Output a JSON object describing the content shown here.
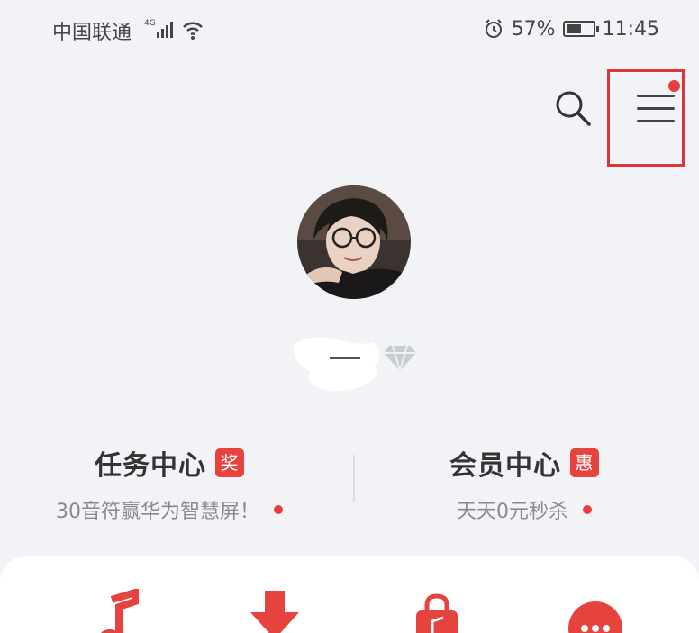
{
  "status_bar": {
    "carrier": "中国联通",
    "network": "4G",
    "battery": "57%",
    "battery_level": 0.57,
    "time": "11:45"
  },
  "header": {
    "search_icon": "search-icon",
    "menu_icon": "menu-icon"
  },
  "profile": {
    "vip_icon": "diamond-icon"
  },
  "task_center": {
    "title": "任务中心",
    "badge": "奖",
    "subtitle": "30音符赢华为智慧屏！"
  },
  "member_center": {
    "title": "会员中心",
    "badge": "惠",
    "subtitle": "天天0元秒杀"
  },
  "quick_icons": [
    "music-note-icon",
    "download-icon",
    "shopping-bag-icon",
    "more-icon"
  ],
  "colors": {
    "accent": "#e6423e",
    "background": "#f1f3f6"
  }
}
